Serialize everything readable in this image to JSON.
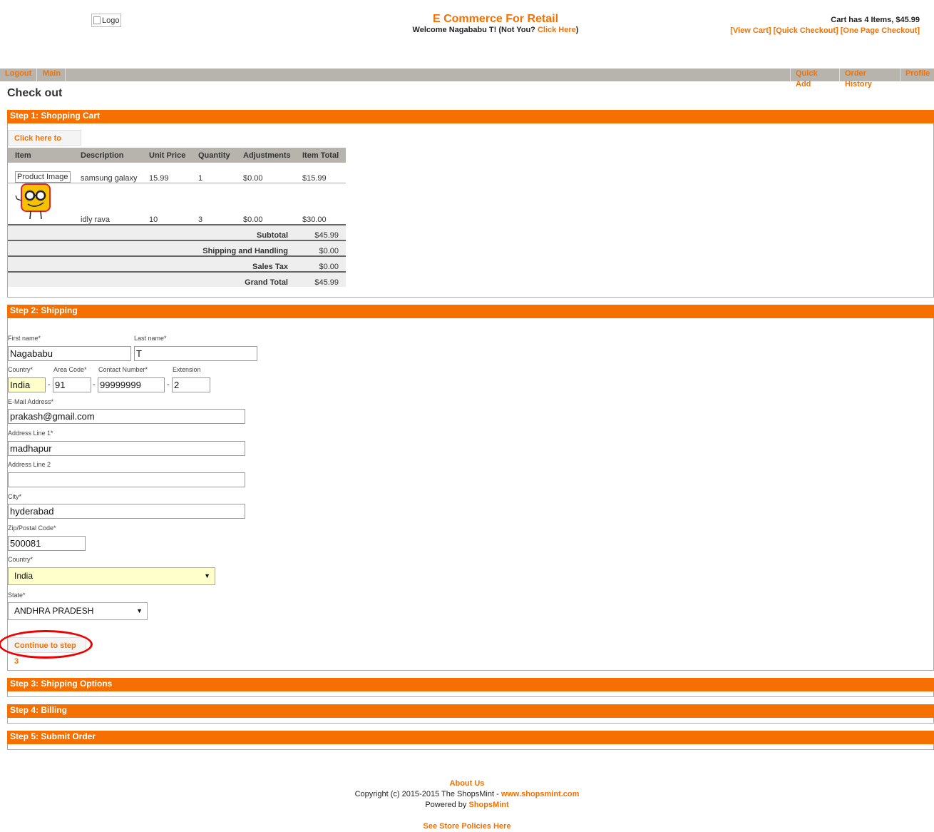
{
  "header": {
    "logo_alt": "Logo",
    "title": "E Commerce For Retail",
    "welcome_text": "Welcome Nagababu T! (Not You?",
    "welcome_link": "Click Here",
    "welcome_close": ")",
    "cart_summary": "Cart has 4 Items, $45.99",
    "view_cart": "[View Cart]",
    "quick_checkout": "[Quick Checkout]",
    "one_page_checkout": "[One Page Checkout]"
  },
  "nav": {
    "logout": "Logout",
    "main": "Main",
    "quick_add": "Quick Add",
    "order_history": "Order History",
    "profile": "Profile"
  },
  "page_title": "Check out",
  "step1": {
    "title": "Step 1: Shopping Cart",
    "edit_button": "Click here to edit",
    "columns": [
      "Item",
      "Description",
      "Unit Price",
      "Quantity",
      "Adjustments",
      "Item Total"
    ],
    "rows": [
      {
        "image": "Product Image",
        "description": "samsung galaxy",
        "unit_price": "15.99",
        "quantity": "1",
        "adjustments": "$0.00",
        "total": "$15.99"
      },
      {
        "image": "",
        "description": "idly rava",
        "unit_price": "10",
        "quantity": "3",
        "adjustments": "$0.00",
        "total": "$30.00"
      }
    ],
    "totals": [
      {
        "label": "Subtotal",
        "value": "$45.99"
      },
      {
        "label": "Shipping and Handling",
        "value": "$0.00"
      },
      {
        "label": "Sales Tax",
        "value": "$0.00"
      },
      {
        "label": "Grand Total",
        "value": "$45.99"
      }
    ]
  },
  "step2": {
    "title": "Step 2: Shipping",
    "first_name_label": "First name*",
    "first_name": "Nagababu",
    "last_name_label": "Last name*",
    "last_name": "T",
    "country_code_label": "Country*",
    "country_code": "India",
    "area_code_label": "Area Code*",
    "area_code": "91",
    "contact_label": "Contact Number*",
    "contact": "99999999",
    "extension_label": "Extension",
    "extension": "2",
    "email_label": "E-Mail Address*",
    "email": "prakash@gmail.com",
    "address1_label": "Address Line 1*",
    "address1": "madhapur",
    "address2_label": "Address Line 2",
    "address2": "",
    "city_label": "City*",
    "city": "hyderabad",
    "zip_label": "Zip/Postal Code*",
    "zip": "500081",
    "country_label": "Country*",
    "country": "India",
    "state_label": "State*",
    "state": "ANDHRA PRADESH",
    "continue_button": "Continue to step 3"
  },
  "step3": {
    "title": "Step 3: Shipping Options"
  },
  "step4": {
    "title": "Step 4: Billing"
  },
  "step5": {
    "title": "Step 5: Submit Order"
  },
  "footer": {
    "about": "About Us",
    "copyright": "Copyright (c) 2015-2015 The ShopsMint -",
    "copyright_link": "www.shopsmint.com",
    "powered_by": "Powered by",
    "powered_link": "ShopsMint",
    "policies": "See Store Policies Here"
  },
  "colors": {
    "accent": "#f57000",
    "nav_bg": "#b7b4ae",
    "highlight": "#ffffcc",
    "annotation": "#e00000"
  }
}
